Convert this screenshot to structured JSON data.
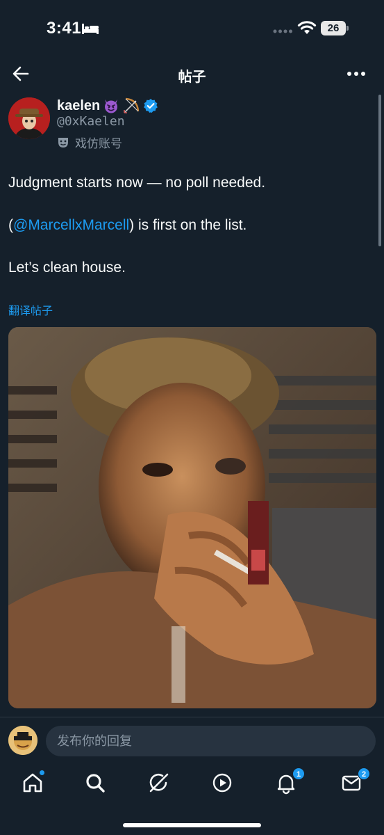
{
  "status_bar": {
    "time": "3:41",
    "battery": "26"
  },
  "header": {
    "title": "帖子"
  },
  "author": {
    "name": "kaelen",
    "handle": "@0xKaelen",
    "parody_label": "戏仿账号",
    "icons": [
      "devil-emoji-icon",
      "bow-and-arrow-emoji-icon",
      "verified-badge-icon",
      "theater-mask-icon"
    ]
  },
  "post": {
    "line1": "Judgment starts now — no poll needed.",
    "line2_prefix": "(",
    "line2_mention": "@MarcellxMarcell",
    "line2_suffix": ") is first on the list.",
    "line3": "Let’s clean house.",
    "translate_label": "翻译帖子"
  },
  "reply": {
    "placeholder": "发布你的回复"
  },
  "nav": {
    "items": [
      "home-icon",
      "search-icon",
      "grok-icon",
      "video-icon",
      "notifications-icon",
      "messages-icon"
    ],
    "notifications_badge": "1",
    "messages_badge": "2"
  },
  "colors": {
    "background": "#15202b",
    "accent": "#1d9bf0",
    "secondary_text": "#8b98a5"
  }
}
